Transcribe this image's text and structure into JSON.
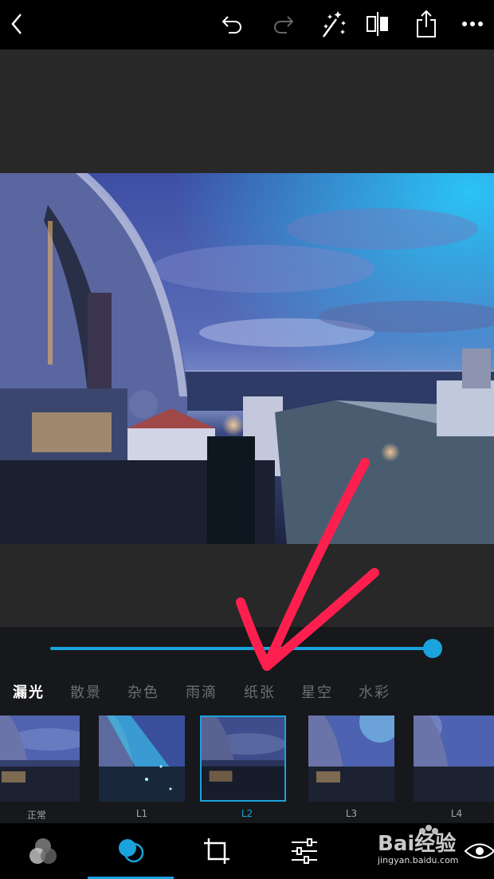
{
  "topbar": {
    "icons": [
      "back-icon",
      "undo-icon",
      "redo-icon",
      "magic-wand-icon",
      "compare-icon",
      "share-icon",
      "more-icon"
    ]
  },
  "editor": {
    "slider_value": 1.0,
    "accent_color": "#1aa3dc",
    "annotation_color": "#ff1f4f"
  },
  "filter_tabs": [
    {
      "label": "漏光",
      "active": true
    },
    {
      "label": "散景",
      "active": false
    },
    {
      "label": "杂色",
      "active": false
    },
    {
      "label": "雨滴",
      "active": false
    },
    {
      "label": "纸张",
      "active": false
    },
    {
      "label": "星空",
      "active": false
    },
    {
      "label": "水彩",
      "active": false
    }
  ],
  "presets": [
    {
      "label": "正常",
      "selected": false
    },
    {
      "label": "L1",
      "selected": false
    },
    {
      "label": "L2",
      "selected": true
    },
    {
      "label": "L3",
      "selected": false
    },
    {
      "label": "L4",
      "selected": false
    }
  ],
  "bottomnav": {
    "items": [
      "color-circles-icon",
      "blend-icon",
      "crop-icon",
      "adjust-sliders-icon",
      "eye-icon"
    ],
    "active": "blend-icon"
  },
  "watermark": {
    "logo_text": "Bai经验",
    "url_text": "jingyan.baidu.com"
  }
}
